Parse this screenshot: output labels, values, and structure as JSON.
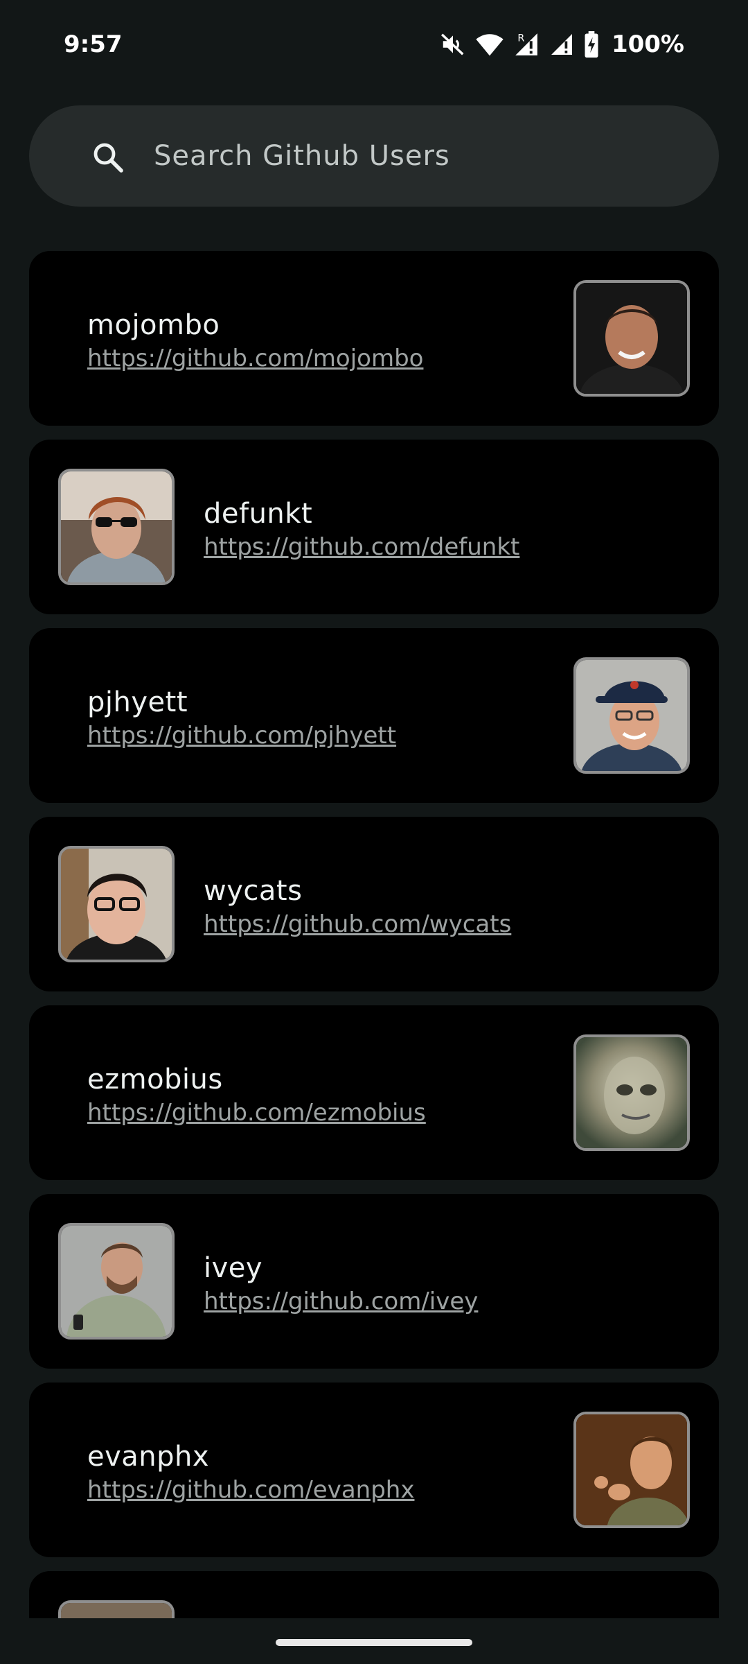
{
  "status_bar": {
    "time": "9:57",
    "battery_percent": "100%",
    "icons": [
      "mute-icon",
      "wifi-icon",
      "signal-roaming-icon",
      "signal-icon",
      "battery-charging-icon"
    ]
  },
  "search": {
    "placeholder": "Search Github Users",
    "icon": "search-icon"
  },
  "users": [
    {
      "login": "mojombo",
      "url": "https://github.com/mojombo",
      "avatar_side": "right"
    },
    {
      "login": "defunkt",
      "url": "https://github.com/defunkt",
      "avatar_side": "left"
    },
    {
      "login": "pjhyett",
      "url": "https://github.com/pjhyett",
      "avatar_side": "right"
    },
    {
      "login": "wycats",
      "url": "https://github.com/wycats",
      "avatar_side": "left"
    },
    {
      "login": "ezmobius",
      "url": "https://github.com/ezmobius",
      "avatar_side": "right"
    },
    {
      "login": "ivey",
      "url": "https://github.com/ivey",
      "avatar_side": "left"
    },
    {
      "login": "evanphx",
      "url": "https://github.com/evanphx",
      "avatar_side": "right"
    }
  ],
  "colors": {
    "background": "#121717",
    "card": "#000000",
    "search_bar": "#262b2b",
    "text_primary": "#eef2f1",
    "link": "#9ea3a3"
  }
}
